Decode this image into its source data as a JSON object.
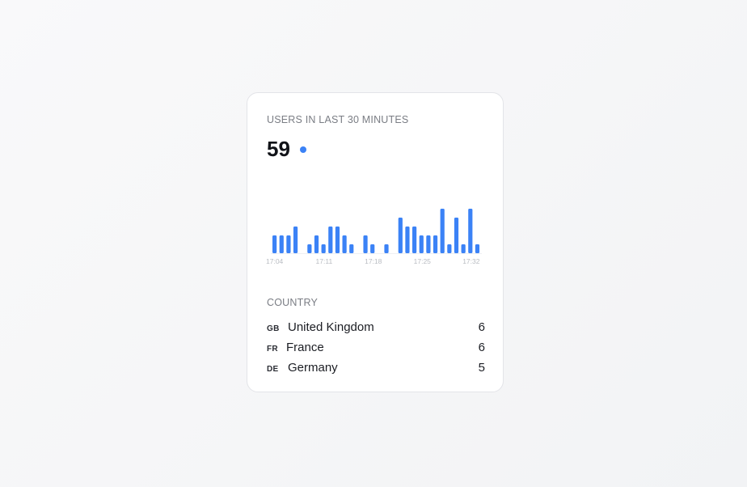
{
  "card": {
    "title": "USERS IN LAST 30 MINUTES",
    "metric_value": "59",
    "accent_color": "#3b82f6"
  },
  "chart_data": {
    "type": "bar",
    "categories": [
      "17:04",
      "17:05",
      "17:06",
      "17:07",
      "17:08",
      "17:09",
      "17:10",
      "17:11",
      "17:12",
      "17:13",
      "17:14",
      "17:15",
      "17:16",
      "17:17",
      "17:18",
      "17:19",
      "17:20",
      "17:21",
      "17:22",
      "17:23",
      "17:24",
      "17:25",
      "17:26",
      "17:27",
      "17:28",
      "17:29",
      "17:30",
      "17:31",
      "17:32",
      "17:33"
    ],
    "values": [
      2,
      2,
      2,
      3,
      0,
      1,
      2,
      1,
      3,
      3,
      2,
      1,
      0,
      2,
      1,
      0,
      1,
      0,
      4,
      3,
      3,
      2,
      2,
      2,
      5,
      1,
      4,
      1,
      5,
      1
    ],
    "tick_labels": [
      "17:04",
      "17:11",
      "17:18",
      "17:25",
      "17:32"
    ],
    "ylim": [
      0,
      5
    ],
    "bar_color": "#3b82f6",
    "grid": false
  },
  "countries": {
    "header": "COUNTRY",
    "rows": [
      {
        "code": "GB",
        "name": "United Kingdom",
        "count": "6"
      },
      {
        "code": "FR",
        "name": "France",
        "count": "6"
      },
      {
        "code": "DE",
        "name": "Germany",
        "count": "5"
      }
    ]
  }
}
